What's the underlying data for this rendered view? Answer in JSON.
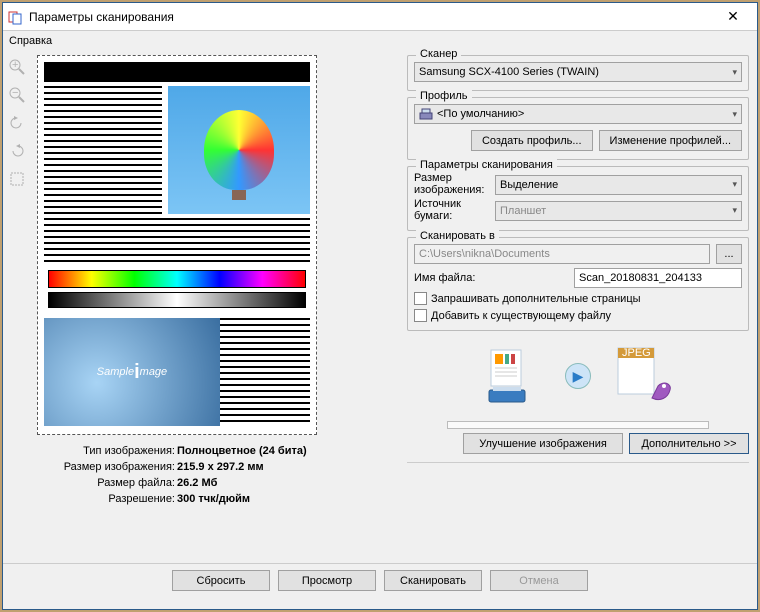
{
  "window": {
    "title": "Параметры сканирования"
  },
  "menubar": {
    "help": "Справка"
  },
  "scanner": {
    "group_label": "Сканер",
    "selected": "Samsung SCX-4100 Series (TWAIN)"
  },
  "profile": {
    "group_label": "Профиль",
    "selected": "<По умолчанию>",
    "create_btn": "Создать профиль...",
    "edit_btn": "Изменение профилей..."
  },
  "scan_params": {
    "group_label": "Параметры сканирования",
    "image_size_label": "Размер изображения:",
    "image_size_value": "Выделение",
    "paper_source_label": "Источник бумаги:",
    "paper_source_value": "Планшет"
  },
  "scan_to": {
    "group_label": "Сканировать в",
    "path": "C:\\Users\\nikna\\Documents",
    "browse": "...",
    "filename_label": "Имя файла:",
    "filename_value": "Scan_20180831_204133",
    "ask_more": "Запрашивать дополнительные страницы",
    "append": "Добавить к существующему файлу"
  },
  "diagram": {
    "output_badge": "JPEG"
  },
  "actions": {
    "enhance": "Улучшение изображения",
    "more": "Дополнительно >>"
  },
  "footer": {
    "reset": "Сбросить",
    "preview": "Просмотр",
    "scan": "Сканировать",
    "cancel": "Отмена"
  },
  "preview": {
    "sample_pre": "Sample ",
    "sample_big": "i",
    "sample_post": "mage"
  },
  "info": {
    "type_label": "Тип изображения:",
    "type_value": "Полноцветное (24 бита)",
    "img_size_label": "Размер изображения:",
    "img_size_value": "215.9 x 297.2 мм",
    "file_size_label": "Размер файла:",
    "file_size_value": "26.2 Мб",
    "res_label": "Разрешение:",
    "res_value": "300 тчк/дюйм"
  }
}
